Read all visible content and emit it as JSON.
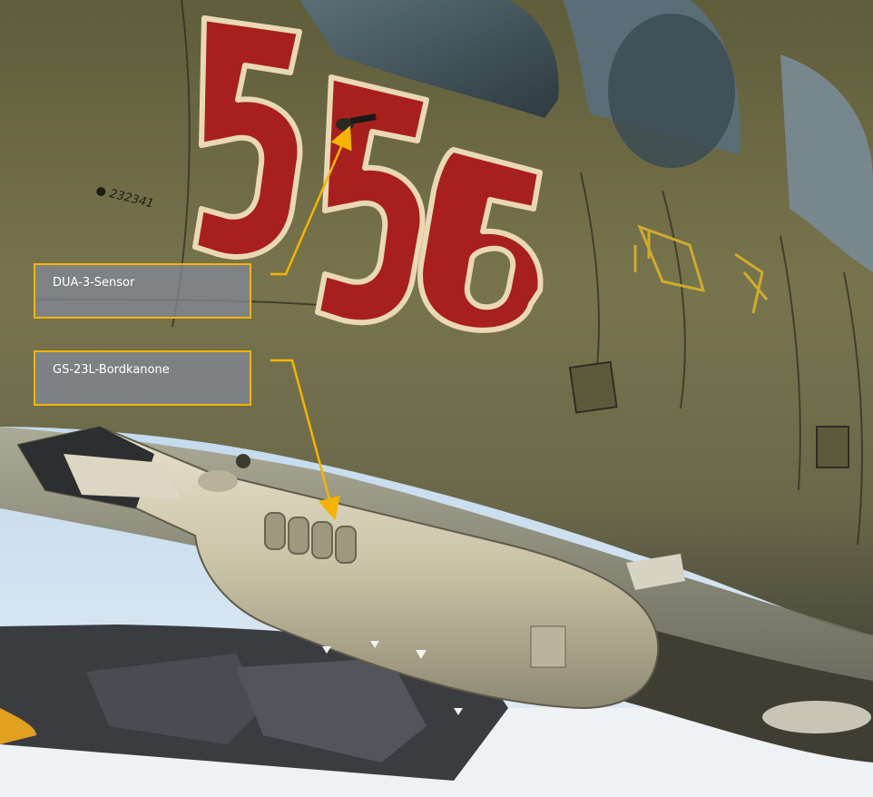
{
  "image": {
    "subject": "underside-fuselage-photo",
    "aircraft_number": "556",
    "serial_stencil": "232341"
  },
  "callouts": [
    {
      "id": "dua-3-sensor",
      "label": "DUA-3-Sensor"
    },
    {
      "id": "gs-23l-gun",
      "label": "GS-23L-Bordkanone"
    }
  ],
  "colors": {
    "callout_border": "#f5b400",
    "callout_fill": "#808694",
    "leader_line": "#f5b400",
    "fuselage": "#6d6b45",
    "number_red": "#a8201d",
    "number_outline": "#ead8b4",
    "sky": "#bfd6ea"
  }
}
